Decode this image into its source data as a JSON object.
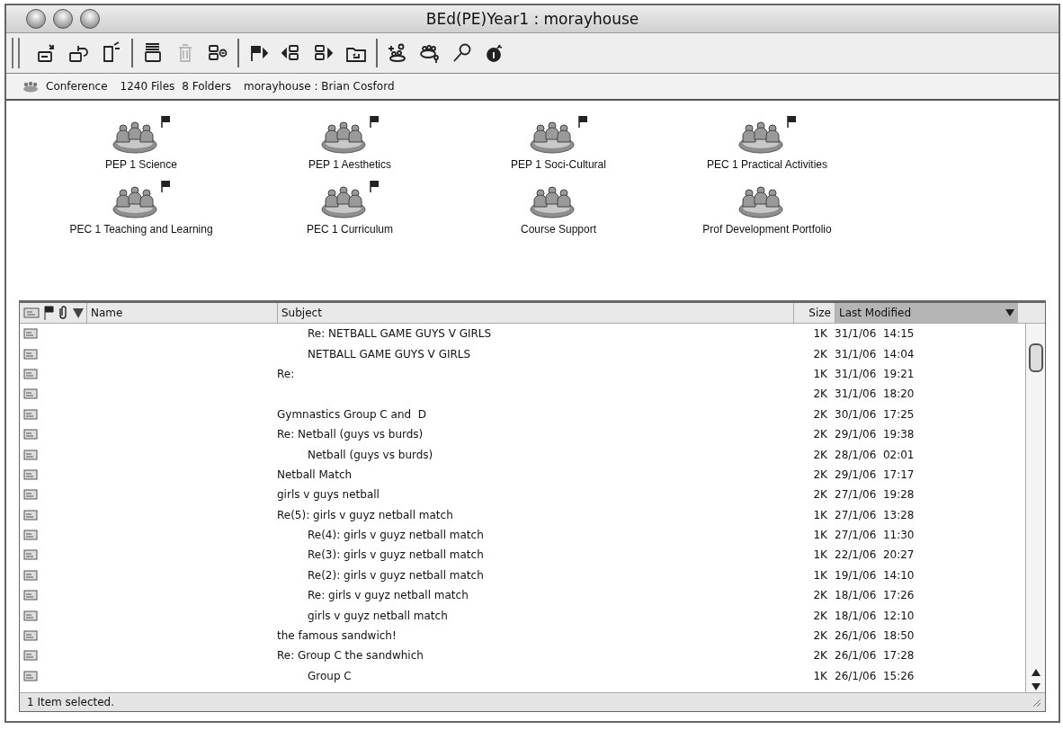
{
  "window": {
    "title": "BEd(PE)Year1 : morayhouse"
  },
  "toolbar": [
    [
      {
        "kind": "new-message",
        "disabled": false
      },
      {
        "kind": "reply",
        "disabled": false
      },
      {
        "kind": "new-document",
        "disabled": false
      }
    ],
    [
      {
        "kind": "message-list",
        "disabled": false
      },
      {
        "kind": "trash",
        "disabled": true
      },
      {
        "kind": "collapse",
        "disabled": false
      }
    ],
    [
      {
        "kind": "flag-next",
        "disabled": false
      },
      {
        "kind": "previous",
        "disabled": false
      },
      {
        "kind": "next",
        "disabled": false
      },
      {
        "kind": "folder-up",
        "disabled": false
      }
    ],
    [
      {
        "kind": "new-conference",
        "disabled": false
      },
      {
        "kind": "conference-key",
        "disabled": false
      },
      {
        "kind": "search",
        "disabled": false
      },
      {
        "kind": "info",
        "disabled": false
      }
    ]
  ],
  "info_bar": {
    "type": "Conference",
    "files": "1240 Files",
    "folders": "8 Folders",
    "location": "morayhouse : Brian Cosford"
  },
  "conferences": [
    {
      "label": "PEP 1 Science",
      "flagged": true
    },
    {
      "label": "PEP 1 Aesthetics",
      "flagged": true
    },
    {
      "label": "PEP 1 Soci-Cultural",
      "flagged": true
    },
    {
      "label": "PEC 1 Practical Activities",
      "flagged": true
    },
    {
      "label": "PEC 1 Teaching and Learning",
      "flagged": true
    },
    {
      "label": "PEC 1 Curriculum",
      "flagged": true
    },
    {
      "label": "Course Support",
      "flagged": false
    },
    {
      "label": "Prof Development Portfolio",
      "flagged": false
    }
  ],
  "table": {
    "columns": [
      {
        "label": "Name",
        "selected": false
      },
      {
        "label": "Subject",
        "selected": false
      },
      {
        "label": "Size",
        "selected": false
      },
      {
        "label": "Last Modified",
        "selected": true
      }
    ],
    "rows": [
      {
        "subject": "Re: NETBALL GAME GUYS V GIRLS",
        "indented": true,
        "size": "1K",
        "modified": "31/1/06  14:15"
      },
      {
        "subject": "NETBALL GAME GUYS V GIRLS",
        "indented": true,
        "size": "2K",
        "modified": "31/1/06  14:04"
      },
      {
        "subject": "Re:",
        "indented": false,
        "size": "1K",
        "modified": "31/1/06  19:21"
      },
      {
        "size": "2K",
        "modified": "31/1/06  18:20"
      },
      {
        "subject": "Gymnastics Group C and  D",
        "indented": false,
        "size": "2K",
        "modified": "30/1/06  17:25"
      },
      {
        "subject": "Re: Netball (guys vs burds)",
        "indented": false,
        "size": "2K",
        "modified": "29/1/06  19:38"
      },
      {
        "subject": "Netball (guys vs burds)",
        "indented": true,
        "size": "2K",
        "modified": "28/1/06  02:01"
      },
      {
        "subject": "Netball Match",
        "indented": false,
        "size": "2K",
        "modified": "29/1/06  17:17"
      },
      {
        "subject": "girls v guys netball",
        "indented": false,
        "size": "2K",
        "modified": "27/1/06  19:28"
      },
      {
        "subject": "Re(5): girls v guyz netball match",
        "indented": false,
        "size": "1K",
        "modified": "27/1/06  13:28"
      },
      {
        "subject": "Re(4): girls v guyz netball match",
        "indented": true,
        "size": "1K",
        "modified": "27/1/06  11:30"
      },
      {
        "subject": "Re(3): girls v guyz netball match",
        "indented": true,
        "size": "1K",
        "modified": "22/1/06  20:27"
      },
      {
        "subject": "Re(2): girls v guyz netball match",
        "indented": true,
        "size": "1K",
        "modified": "19/1/06  14:10"
      },
      {
        "subject": "Re: girls v guyz netball match",
        "indented": true,
        "size": "2K",
        "modified": "18/1/06  17:26"
      },
      {
        "subject": "girls v guyz netball match",
        "indented": true,
        "size": "2K",
        "modified": "18/1/06  12:10"
      },
      {
        "subject": "the famous sandwich!",
        "indented": false,
        "size": "2K",
        "modified": "26/1/06  18:50"
      },
      {
        "subject": "Re: Group C the sandwhich",
        "indented": false,
        "size": "2K",
        "modified": "26/1/06  17:28"
      },
      {
        "subject": "Group C",
        "indented": true,
        "size": "1K",
        "modified": "26/1/06  15:26"
      }
    ]
  },
  "status_bar": "1 Item selected."
}
